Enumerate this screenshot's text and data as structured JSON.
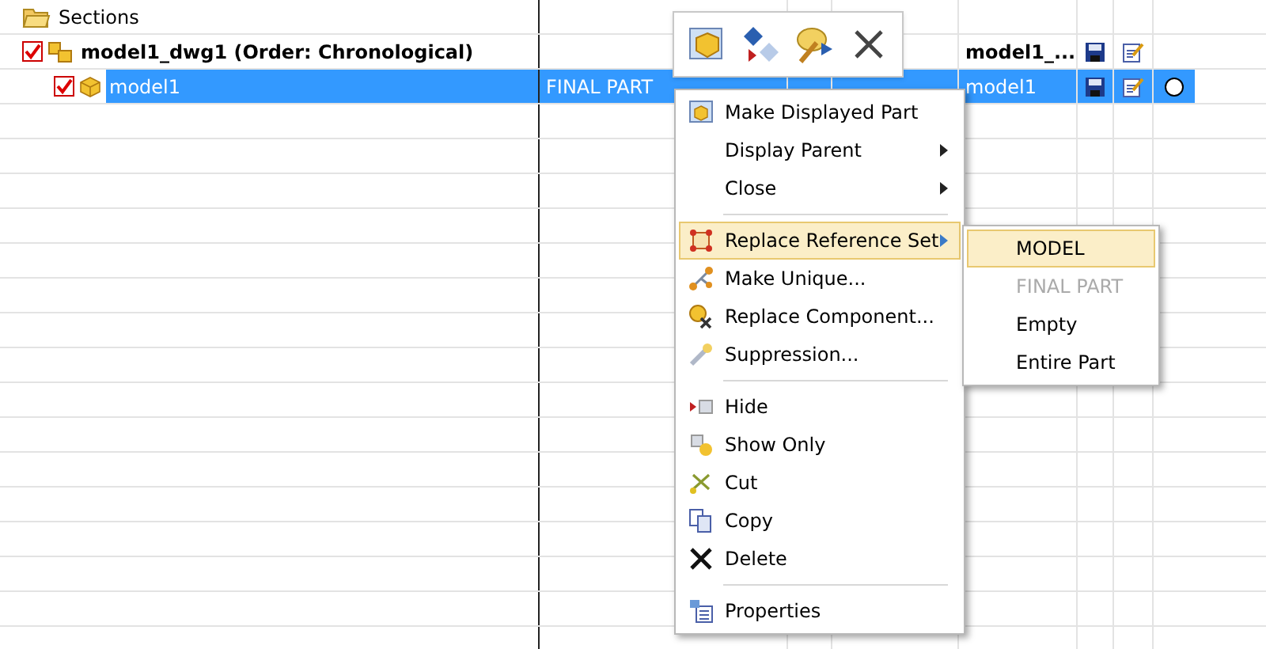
{
  "tree": [
    {
      "kind": "folder",
      "label": "Sections",
      "selected": false
    },
    {
      "kind": "assembly",
      "label": "model1_dwg1 (Order: Chronological)",
      "checked": true,
      "selected": false,
      "component_name": "model1_...",
      "children": [
        {
          "kind": "part",
          "label": "model1",
          "checked": true,
          "selected": true,
          "reference_set": "FINAL PART",
          "component_name": "model1"
        }
      ]
    }
  ],
  "toolbar": [
    {
      "kind": "display"
    },
    {
      "kind": "parent"
    },
    {
      "kind": "paint"
    },
    {
      "kind": "close"
    }
  ],
  "context_menu": [
    {
      "kind": "item",
      "label": "Make Displayed Part",
      "submenu": false,
      "selected": false
    },
    {
      "kind": "item",
      "label": "Display Parent",
      "submenu": true,
      "selected": false
    },
    {
      "kind": "item",
      "label": "Close",
      "submenu": true,
      "selected": false
    },
    {
      "kind": "separator"
    },
    {
      "kind": "item",
      "label": "Replace Reference Set",
      "submenu": true,
      "selected": true
    },
    {
      "kind": "item",
      "label": "Make Unique...",
      "submenu": false,
      "selected": false
    },
    {
      "kind": "item",
      "label": "Replace Component...",
      "submenu": false,
      "selected": false
    },
    {
      "kind": "item",
      "label": "Suppression...",
      "submenu": false,
      "selected": false
    },
    {
      "kind": "separator"
    },
    {
      "kind": "item",
      "label": "Hide",
      "submenu": false,
      "selected": false
    },
    {
      "kind": "item",
      "label": "Show Only",
      "submenu": false,
      "selected": false
    },
    {
      "kind": "item",
      "label": "Cut",
      "submenu": false,
      "selected": false
    },
    {
      "kind": "item",
      "label": "Copy",
      "submenu": false,
      "selected": false
    },
    {
      "kind": "item",
      "label": "Delete",
      "submenu": false,
      "selected": false
    },
    {
      "kind": "separator"
    },
    {
      "kind": "item",
      "label": "Properties",
      "submenu": false,
      "selected": false
    }
  ],
  "submenu": [
    {
      "label": "MODEL",
      "selected": true,
      "disabled": false
    },
    {
      "label": "FINAL PART",
      "selected": false,
      "disabled": true
    },
    {
      "label": "Empty",
      "selected": false,
      "disabled": false
    },
    {
      "label": "Entire Part",
      "selected": false,
      "disabled": false
    }
  ]
}
